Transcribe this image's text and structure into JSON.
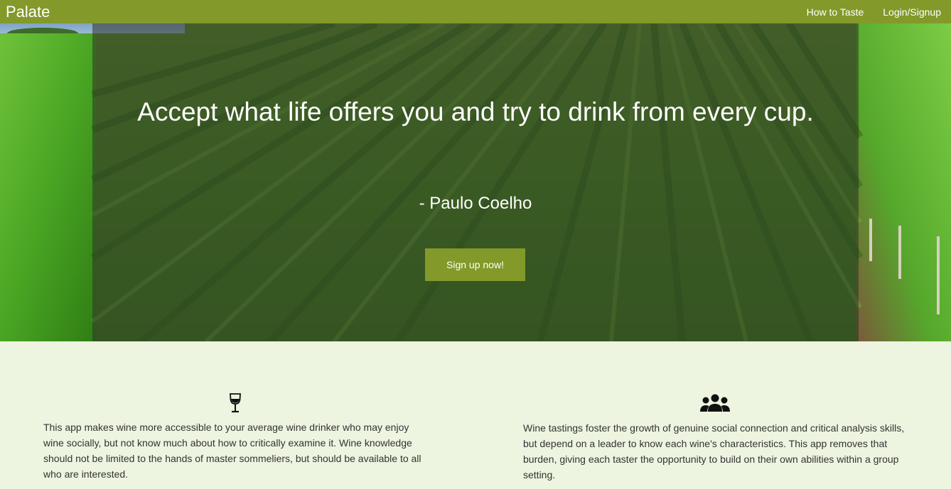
{
  "navbar": {
    "brand": "Palate",
    "links": [
      "How to Taste",
      "Login/Signup"
    ]
  },
  "hero": {
    "quote": "Accept what life offers you and try to drink from every cup.",
    "author": "- Paulo Coelho",
    "cta_label": "Sign up now!"
  },
  "features": [
    {
      "icon": "wine-glass-icon",
      "text": "This app makes wine more accessible to your average wine drinker who may enjoy wine socially, but not know much about how to critically examine it. Wine knowledge should not be limited to the hands of master sommeliers, but should be available to all who are interested."
    },
    {
      "icon": "users-icon",
      "text": "Wine tastings foster the growth of genuine social connection and critical analysis skills, but depend on a leader to know each wine's characteristics. This app removes that burden, giving each taster the opportunity to build on their own abilities within a group setting."
    }
  ],
  "colors": {
    "accent": "#83992a",
    "section_bg": "#edf4e0"
  }
}
